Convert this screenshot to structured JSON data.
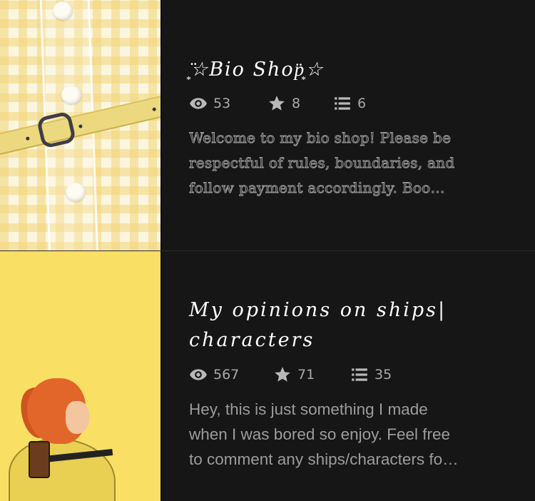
{
  "stories": [
    {
      "title": "͙̈☆Bio Shop͙̈☆",
      "title_lines": [
        "͙̈☆Bio Shop͙̈☆"
      ],
      "cover": "yellow-gingham-dress-with-belt",
      "stats": {
        "views": "53",
        "votes": "8",
        "parts": "6"
      },
      "description_lines": [
        "Welcome to my bio shop! Please be",
        "respectful of rules, boundaries, and",
        "follow payment accordingly.  Boo…"
      ]
    },
    {
      "title": "My opinions on ships| characters",
      "title_lines": [
        "My opinions on ships|",
        "characters"
      ],
      "cover": "yellow-poster-with-red-haired-woman-holding-mallet",
      "stats": {
        "views": "567",
        "votes": "71",
        "parts": "35"
      },
      "description_lines": [
        "Hey, this is just something I made",
        "when I was bored so enjoy.  Feel free",
        "to comment any ships/characters fo…"
      ]
    }
  ],
  "icons": {
    "views": "eye-icon",
    "votes": "star-icon",
    "parts": "list-icon"
  },
  "colors": {
    "background": "#141414",
    "title": "#ffffff",
    "stat_text": "#a9a9a9",
    "description": "#9c9c9c",
    "cover_yellow": "#f9e064"
  }
}
